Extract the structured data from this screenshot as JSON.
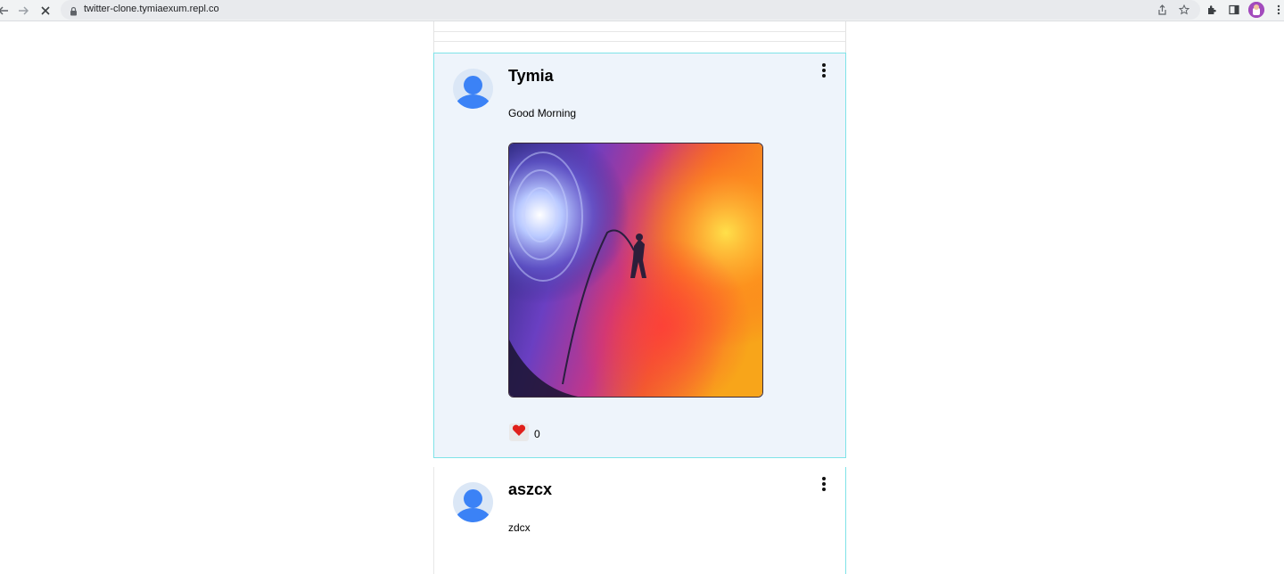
{
  "browser": {
    "url": "twitter-clone.tymiaexum.repl.co",
    "back_icon": "arrow-left-icon",
    "forward_icon": "arrow-right-icon",
    "stop_icon": "close-icon"
  },
  "feed": {
    "tweets": [
      {
        "author": "Tymia",
        "content": "Good Morning",
        "has_image": true,
        "likes": "0"
      },
      {
        "author": "aszcx",
        "content": "zdcx"
      }
    ]
  },
  "colors": {
    "active_bg": "#eef4fb",
    "active_border": "#7fe3e8",
    "avatar_blue": "#3b82f6",
    "like_red": "#e0201b"
  }
}
